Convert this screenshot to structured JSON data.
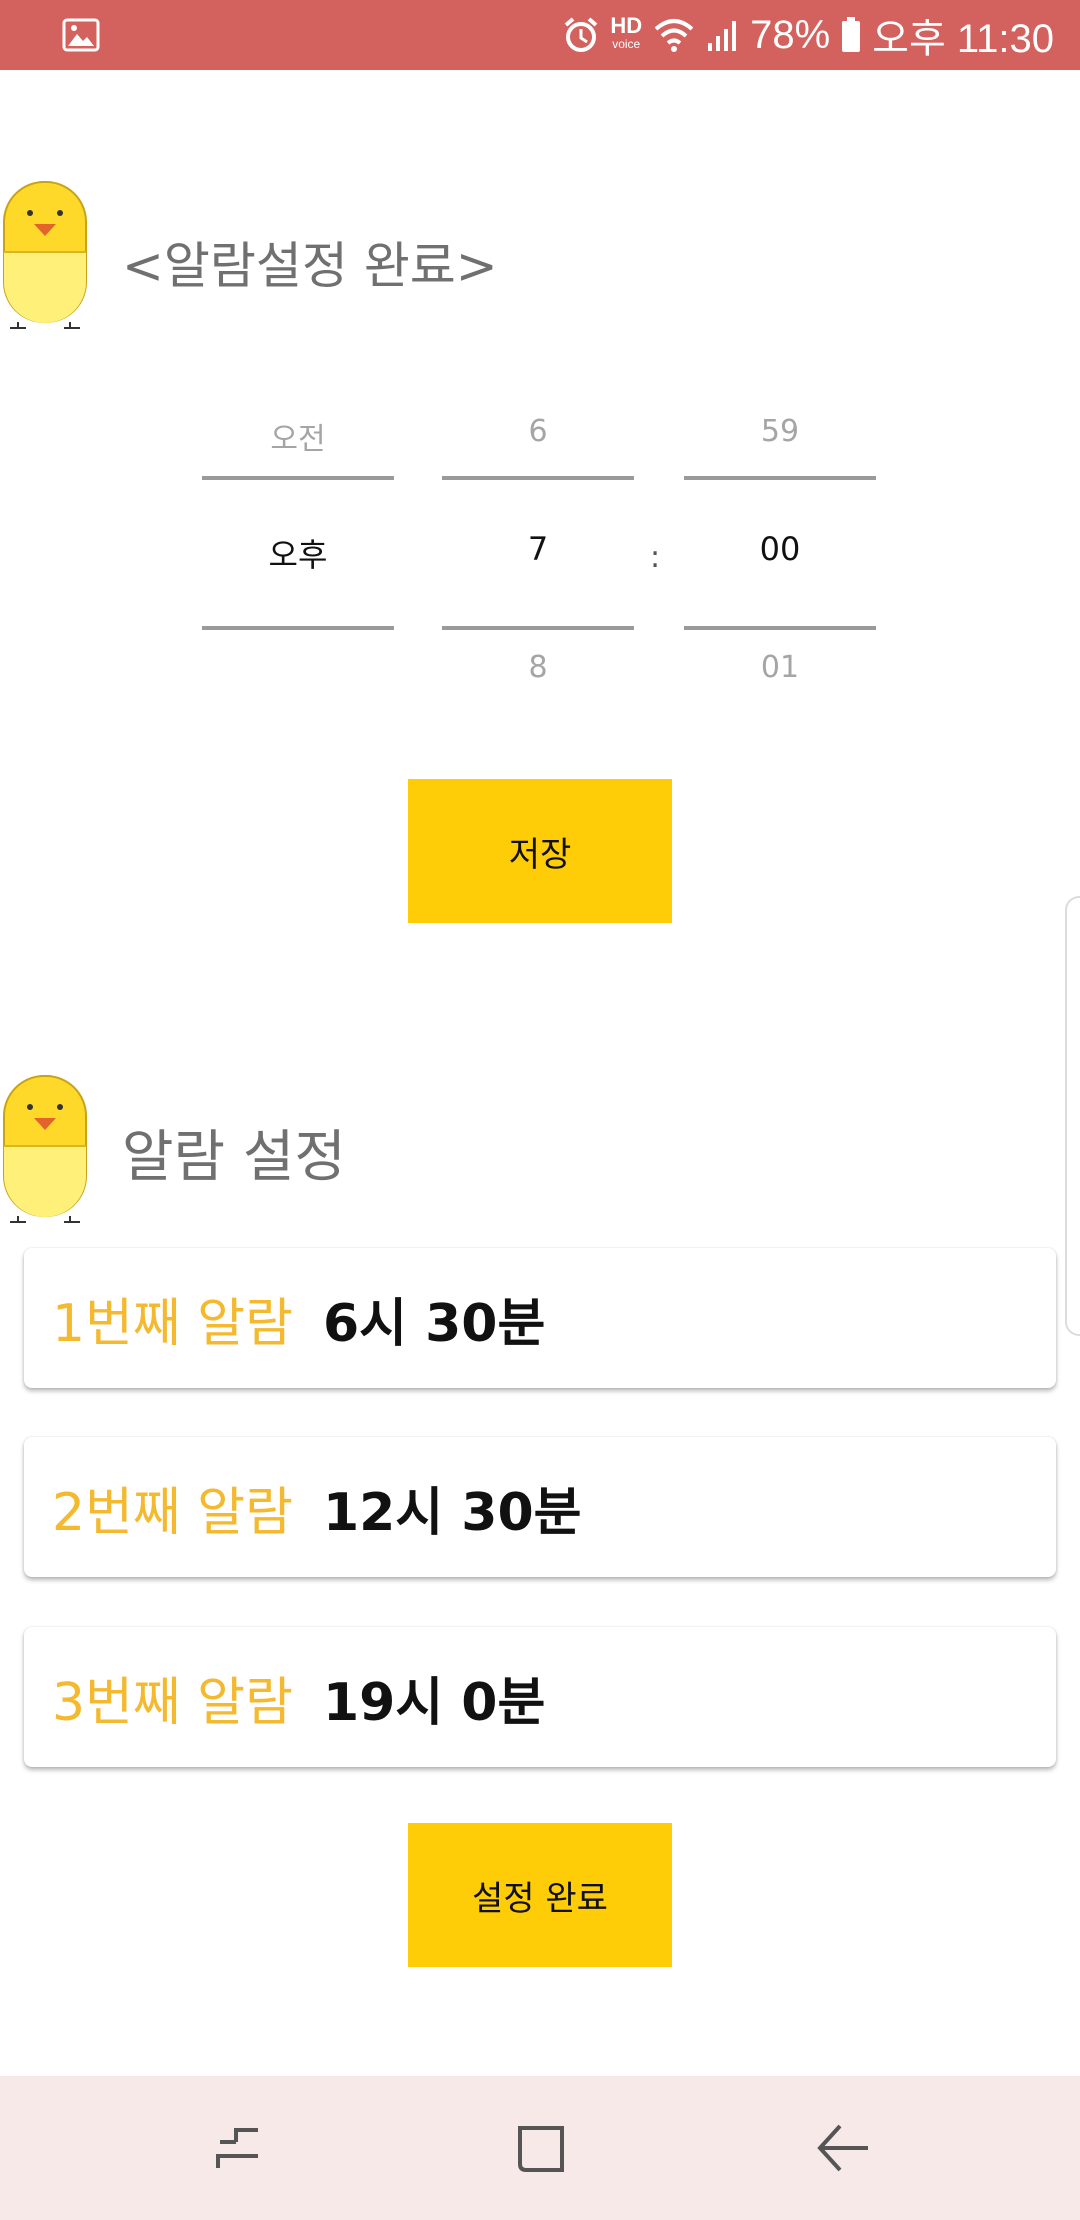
{
  "status_bar": {
    "hd_label": "HD",
    "voice_label": "voice",
    "battery": "78%",
    "time": "오후 11:30",
    "icons": [
      "gallery-icon",
      "alarm-icon",
      "wifi-icon",
      "signal-icon",
      "battery-icon"
    ]
  },
  "section1": {
    "title": "<알람설정 완료>"
  },
  "picker": {
    "ampm": {
      "above": "오전",
      "selected": "오후",
      "below": ""
    },
    "hour": {
      "above": "6",
      "selected": "7",
      "below": "8"
    },
    "separator": ":",
    "minute": {
      "above": "59",
      "selected": "00",
      "below": "01"
    }
  },
  "save_button": {
    "label": "저장"
  },
  "section2": {
    "title": "알람 설정"
  },
  "alarms": [
    {
      "label": "1번째 알람",
      "time": "6시 30분"
    },
    {
      "label": "2번째 알람",
      "time": "12시 30분"
    },
    {
      "label": "3번째 알람",
      "time": "19시 0분"
    }
  ],
  "done_button": {
    "label": "설정 완료"
  },
  "colors": {
    "status_bar": "#d3615e",
    "accent_yellow": "#fecd07",
    "alarm_label": "#f4b92f",
    "nav_bar": "#f6e9e7"
  },
  "nav": {
    "icons": [
      "recent-apps-icon",
      "home-icon",
      "back-icon"
    ]
  }
}
